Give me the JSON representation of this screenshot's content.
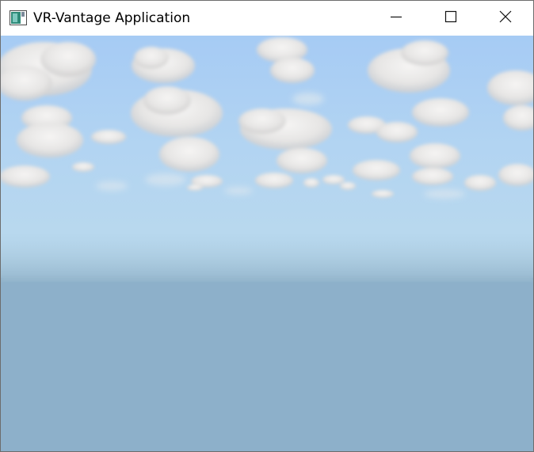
{
  "window": {
    "title": "VR-Vantage Application",
    "icon": "application-window-icon",
    "controls": [
      "minimize-icon",
      "maximize-icon",
      "close-icon"
    ]
  },
  "scene": {
    "content": "3d-viewport",
    "colors": {
      "sky_top": "#a8cdf4",
      "sky_horizon": "#b5d6ee",
      "haze": "#a3c4d8",
      "ground": "#8db0ca",
      "cloud": "#f2f1f0",
      "cloud_shadow": "#c9c8c8"
    }
  }
}
